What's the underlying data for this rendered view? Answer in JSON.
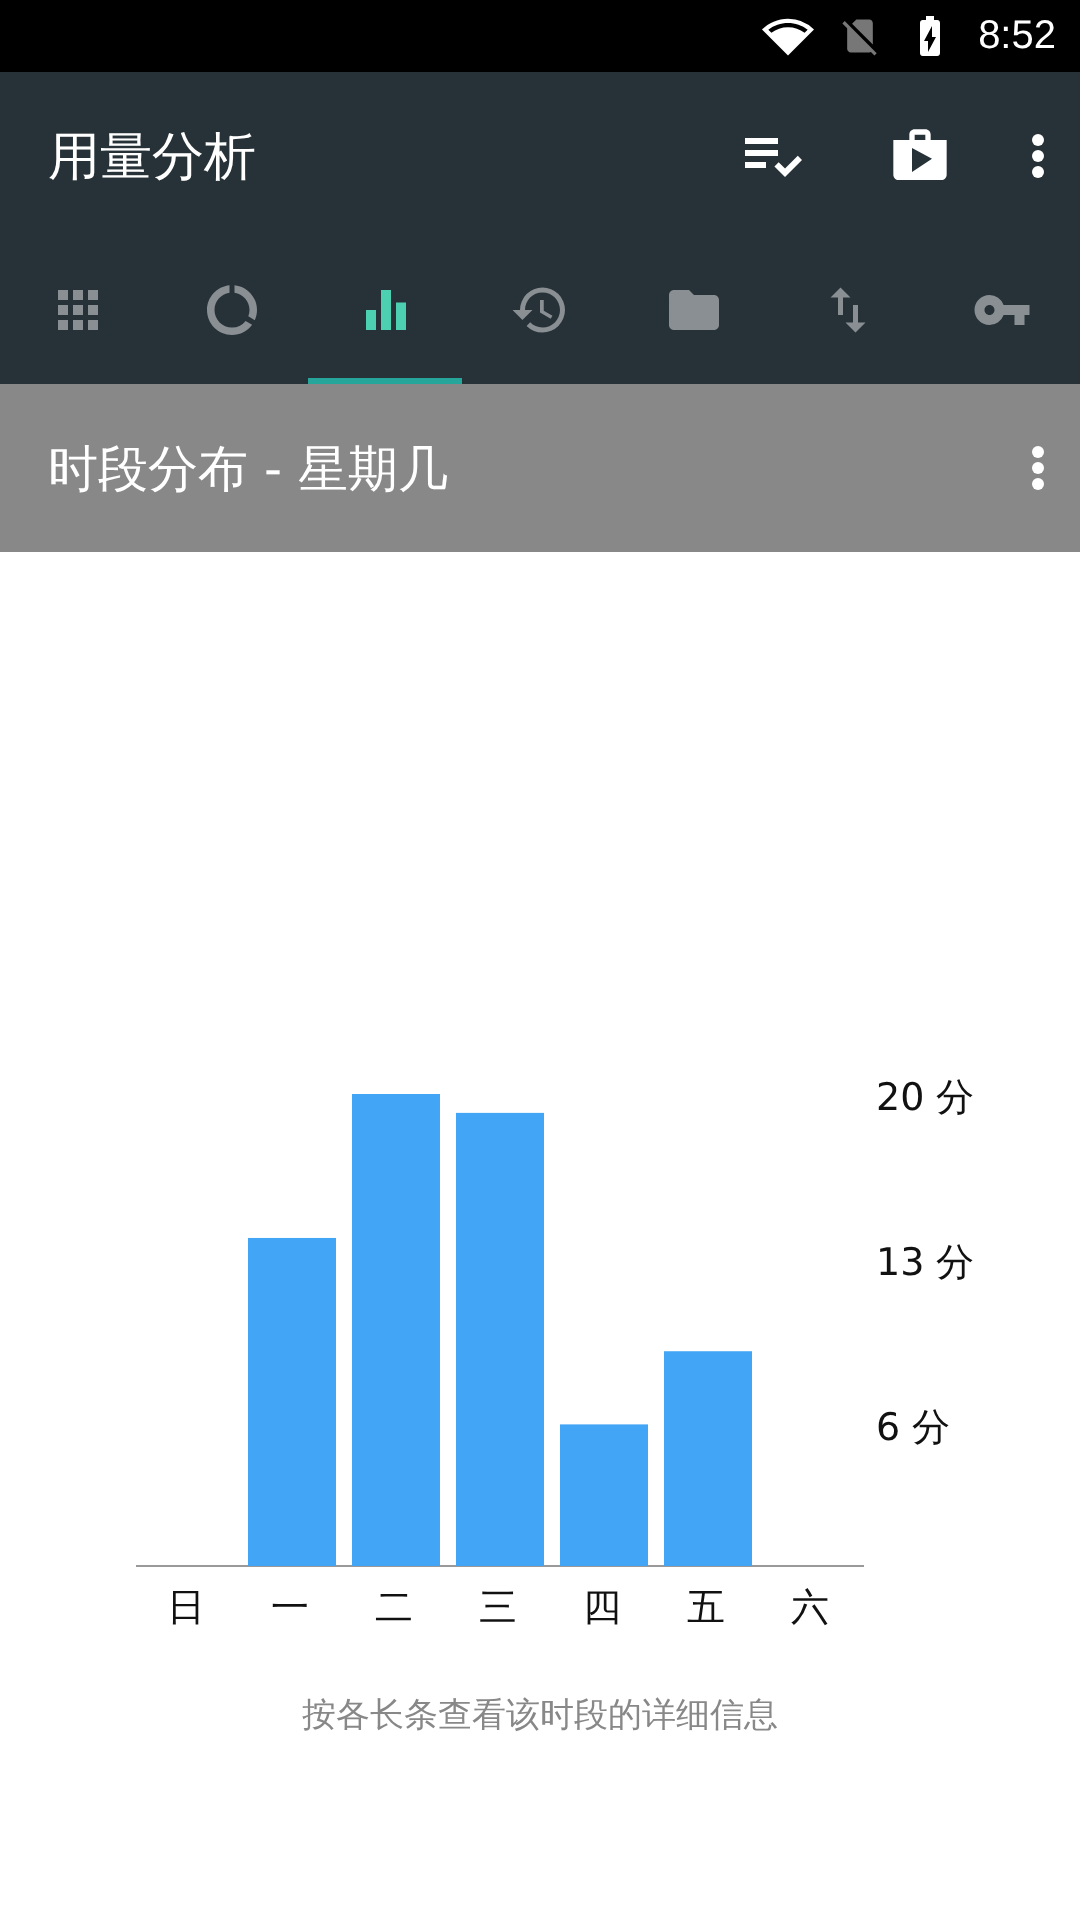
{
  "status_bar": {
    "time": "8:52"
  },
  "toolbar": {
    "title": "用量分析"
  },
  "tabs": [
    {
      "selected": false
    },
    {
      "selected": false
    },
    {
      "selected": true
    },
    {
      "selected": false
    },
    {
      "selected": false
    },
    {
      "selected": false
    },
    {
      "selected": false
    }
  ],
  "section": {
    "title": "时段分布 - 星期几"
  },
  "chart_data": {
    "type": "bar",
    "categories": [
      "日",
      "一",
      "二",
      "三",
      "四",
      "五",
      "六"
    ],
    "series": [
      {
        "color": "#42a5f5",
        "values": [
          0,
          13.9,
          20,
          19.2,
          6,
          9.1,
          0
        ]
      }
    ],
    "ylim": [
      0,
      20
    ],
    "yticks": [
      {
        "value": 6,
        "label": "6 分"
      },
      {
        "value": 13,
        "label": "13 分"
      },
      {
        "value": 20,
        "label": "20 分"
      }
    ]
  },
  "hint": "按各长条查看该时段的详细信息"
}
